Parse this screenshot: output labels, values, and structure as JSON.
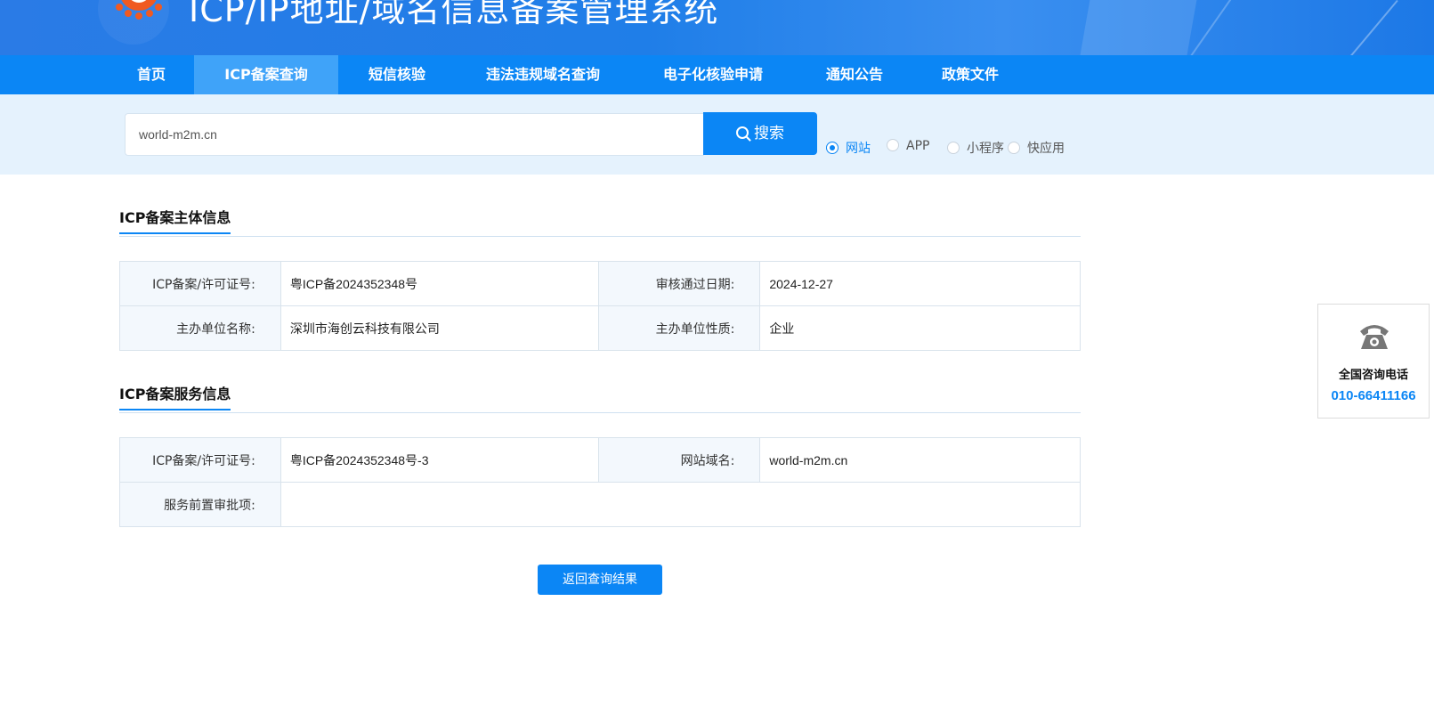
{
  "header": {
    "system_title": "ICP/IP地址/域名信息备案管理系统"
  },
  "nav": {
    "items": [
      {
        "label": "首页"
      },
      {
        "label": "ICP备案查询"
      },
      {
        "label": "短信核验"
      },
      {
        "label": "违法违规域名查询"
      },
      {
        "label": "电子化核验申请"
      },
      {
        "label": "通知公告"
      },
      {
        "label": "政策文件"
      }
    ],
    "active": "ICP备案查询"
  },
  "search": {
    "value": "world-m2m.cn",
    "button_label": "搜索",
    "options": [
      {
        "label": "网站",
        "checked": true
      },
      {
        "label": "APP",
        "checked": false
      },
      {
        "label": "小程序",
        "checked": false
      },
      {
        "label": "快应用",
        "checked": false
      }
    ]
  },
  "subject_info": {
    "title": "ICP备案主体信息",
    "rows": [
      {
        "label1": "ICP备案/许可证号:",
        "value1": "粤ICP备2024352348号",
        "label2": "审核通过日期:",
        "value2": "2024-12-27"
      },
      {
        "label1": "主办单位名称:",
        "value1": "深圳市海创云科技有限公司",
        "label2": "主办单位性质:",
        "value2": "企业"
      }
    ]
  },
  "service_info": {
    "title": "ICP备案服务信息",
    "row1": {
      "label1": "ICP备案/许可证号:",
      "value1": "粤ICP备2024352348号-3",
      "label2": "网站域名:",
      "value2": "world-m2m.cn"
    },
    "row2": {
      "label": "服务前置审批项:",
      "value": ""
    }
  },
  "actions": {
    "return_label": "返回查询结果"
  },
  "hotline": {
    "label": "全国咨询电话",
    "number": "010-66411166"
  },
  "colors": {
    "primary": "#0b86f5",
    "nav_active": "#3fa3f9",
    "search_strip": "#e5f2fd",
    "label_cell": "#f3f8fd"
  }
}
